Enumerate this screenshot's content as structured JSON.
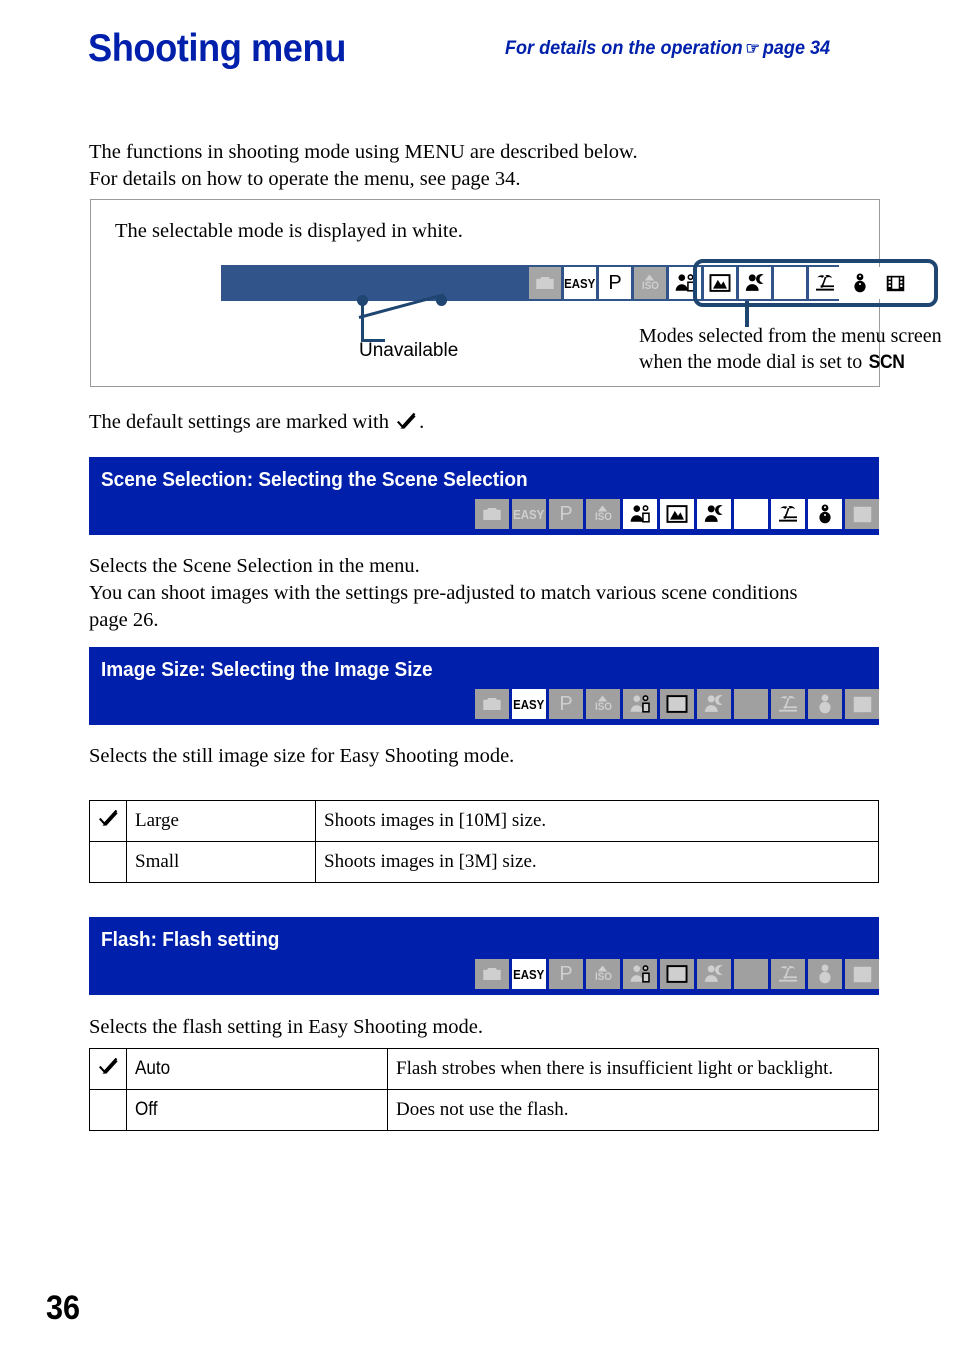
{
  "header": {
    "title": "Shooting menu",
    "note_prefix": "For details on the operation",
    "note_hand_icon": "pointing-hand-icon",
    "note_suffix": "page 34",
    "title_color": "#0020ac"
  },
  "intro": {
    "line1": "The functions in shooting mode using MENU are described below.",
    "line2": "For details on how to operate the menu, see page 34."
  },
  "legend": {
    "caption": "The selectable mode is displayed in white.",
    "unavailable_label": "Unavailable",
    "scn_note_line1": "Modes selected from the menu screen",
    "scn_note_line2_prefix": "when the mode dial is set to",
    "scn_note_dial": "SCN",
    "strip_color": "#31548a",
    "frame_color": "#1f4571",
    "icons": [
      {
        "name": "camera-icon",
        "label": "",
        "available": false
      },
      {
        "name": "easy-icon",
        "label": "EASY",
        "available": true
      },
      {
        "name": "program-p-icon",
        "label": "P",
        "available": true
      },
      {
        "name": "iso-icon",
        "label": "ISO",
        "available": false
      },
      {
        "name": "soft-snap-icon",
        "label": "",
        "available": true
      },
      {
        "name": "landscape-icon",
        "label": "",
        "available": true
      },
      {
        "name": "twilight-portrait-icon",
        "label": "",
        "available": true
      },
      {
        "name": "twilight-icon",
        "label": "",
        "available": true
      },
      {
        "name": "beach-icon",
        "label": "",
        "available": true
      },
      {
        "name": "snow-icon",
        "label": "",
        "available": true
      },
      {
        "name": "movie-icon",
        "label": "",
        "available": true
      }
    ]
  },
  "default_note": {
    "text_before": "The default settings are marked with",
    "check_icon": "check-mark-icon",
    "text_after": "."
  },
  "sections": [
    {
      "id": "scene-selection",
      "title": "Scene Selection: Selecting the Scene Selection",
      "bar_color": "#0020ac",
      "icons": [
        {
          "name": "camera-icon",
          "label": "",
          "available": false
        },
        {
          "name": "easy-icon",
          "label": "EASY",
          "available": false
        },
        {
          "name": "program-p-icon",
          "label": "P",
          "available": false
        },
        {
          "name": "iso-icon",
          "label": "ISO",
          "available": false
        },
        {
          "name": "soft-snap-icon",
          "label": "",
          "available": true
        },
        {
          "name": "landscape-icon",
          "label": "",
          "available": true
        },
        {
          "name": "twilight-portrait-icon",
          "label": "",
          "available": true
        },
        {
          "name": "twilight-icon",
          "label": "",
          "available": true
        },
        {
          "name": "beach-icon",
          "label": "",
          "available": true
        },
        {
          "name": "snow-icon",
          "label": "",
          "available": true
        },
        {
          "name": "movie-icon",
          "label": "",
          "available": false
        }
      ],
      "body": "Selects the Scene Selection in the menu.\nYou can shoot images with the settings pre-adjusted to match various scene conditions\npage 26."
    },
    {
      "id": "image-size",
      "title": "Image Size: Selecting the Image Size",
      "bar_color": "#0020ac",
      "icons": [
        {
          "name": "camera-icon",
          "label": "",
          "available": false
        },
        {
          "name": "easy-icon",
          "label": "EASY",
          "available": true
        },
        {
          "name": "program-p-icon",
          "label": "P",
          "available": false
        },
        {
          "name": "iso-icon",
          "label": "ISO",
          "available": false
        },
        {
          "name": "soft-snap-icon",
          "label": "",
          "available": false
        },
        {
          "name": "landscape-icon",
          "label": "",
          "available": false
        },
        {
          "name": "twilight-portrait-icon",
          "label": "",
          "available": false
        },
        {
          "name": "twilight-icon",
          "label": "",
          "available": false
        },
        {
          "name": "beach-icon",
          "label": "",
          "available": false
        },
        {
          "name": "snow-icon",
          "label": "",
          "available": false
        },
        {
          "name": "movie-icon",
          "label": "",
          "available": false
        }
      ],
      "body": "Selects the still image size for Easy Shooting mode."
    },
    {
      "id": "flash",
      "title": "Flash: Flash setting",
      "bar_color": "#0020ac",
      "icons": [
        {
          "name": "camera-icon",
          "label": "",
          "available": false
        },
        {
          "name": "easy-icon",
          "label": "EASY",
          "available": true
        },
        {
          "name": "program-p-icon",
          "label": "P",
          "available": false
        },
        {
          "name": "iso-icon",
          "label": "ISO",
          "available": false
        },
        {
          "name": "soft-snap-icon",
          "label": "",
          "available": false
        },
        {
          "name": "landscape-icon",
          "label": "",
          "available": false
        },
        {
          "name": "twilight-portrait-icon",
          "label": "",
          "available": false
        },
        {
          "name": "twilight-icon",
          "label": "",
          "available": false
        },
        {
          "name": "beach-icon",
          "label": "",
          "available": false
        },
        {
          "name": "snow-icon",
          "label": "",
          "available": false
        },
        {
          "name": "movie-icon",
          "label": "",
          "available": false
        }
      ],
      "body": "Selects the flash setting in Easy Shooting mode."
    }
  ],
  "tables": {
    "image_size": {
      "rows": [
        {
          "default": true,
          "name": "Large",
          "desc": "Shoots images in [10M] size."
        },
        {
          "default": false,
          "name": "Small",
          "desc": "Shoots images in [3M] size."
        }
      ]
    },
    "flash": {
      "rows": [
        {
          "default": true,
          "name": "Auto",
          "desc": "Flash strobes when there is insufficient light or backlight."
        },
        {
          "default": false,
          "name": "Off",
          "desc": "Does not use the flash."
        }
      ]
    }
  },
  "footer": {
    "page_number": "36"
  }
}
